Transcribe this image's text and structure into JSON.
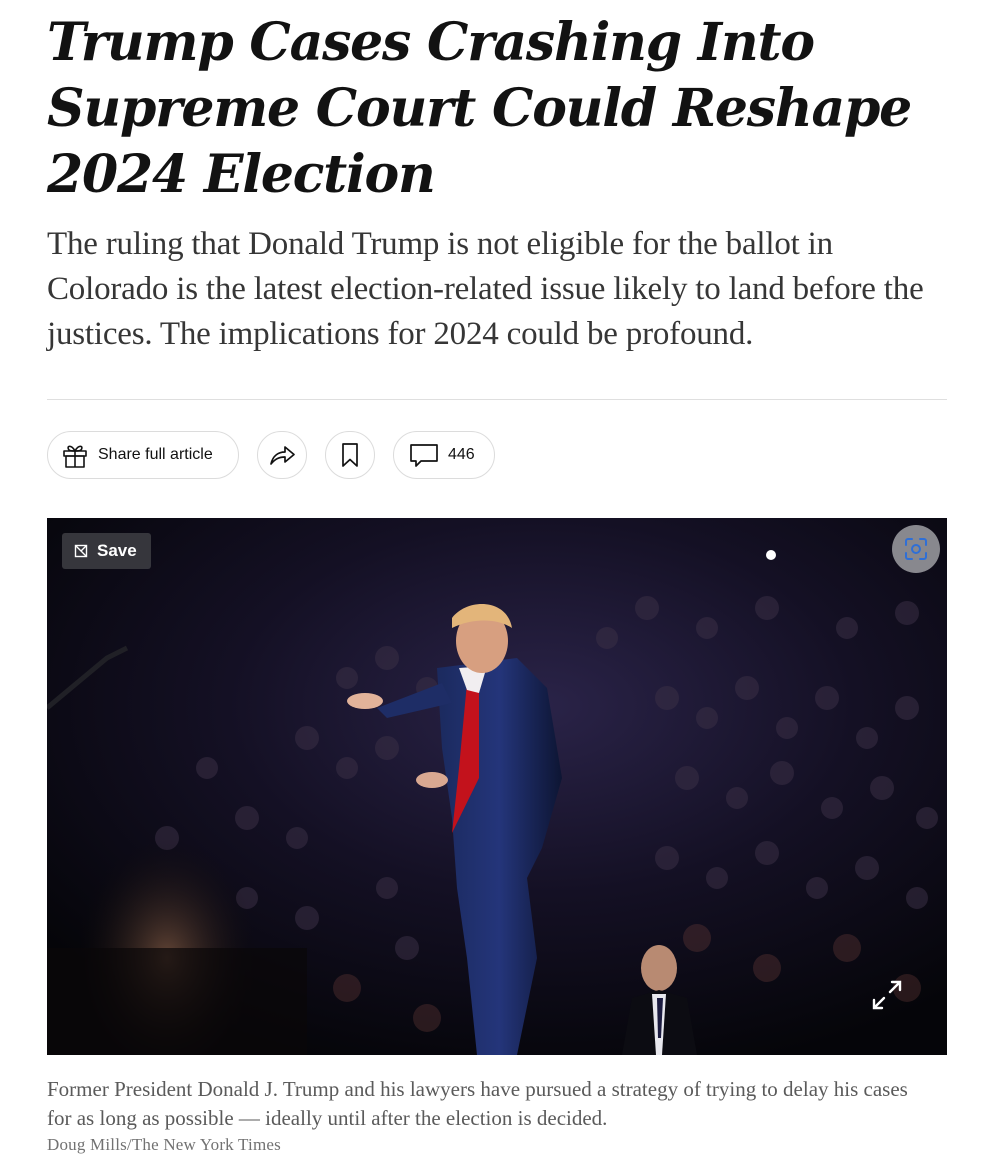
{
  "article": {
    "headline": "Trump Cases Crashing Into Supreme Court Could Reshape 2024 Election",
    "summary": "The ruling that Donald Trump is not eligible for the ballot in Colorado is the latest election-related issue likely to land before the justices. The implications for 2024 could be profound."
  },
  "share_tools": {
    "share_label": "Share full article",
    "share_icon": "gift-icon",
    "forward_icon": "share-arrow-icon",
    "bookmark_icon": "bookmark-icon",
    "comment_icon": "comment-icon",
    "comment_count": "446"
  },
  "figure": {
    "save_label": "Save",
    "save_icon": "save-icon",
    "scan_icon": "scan-icon",
    "expand_icon": "expand-icon",
    "caption": "Former President Donald J. Trump and his lawyers have pursued a strategy of trying to delay his cases for as long as possible — ideally until after the election is decided.",
    "credit": "Doug Mills/The New York Times"
  },
  "colors": {
    "text": "#121212",
    "summary": "#363636",
    "caption": "#5a5a5a",
    "divider": "#dfdfdf",
    "scan_icon": "#2f6fd6"
  }
}
